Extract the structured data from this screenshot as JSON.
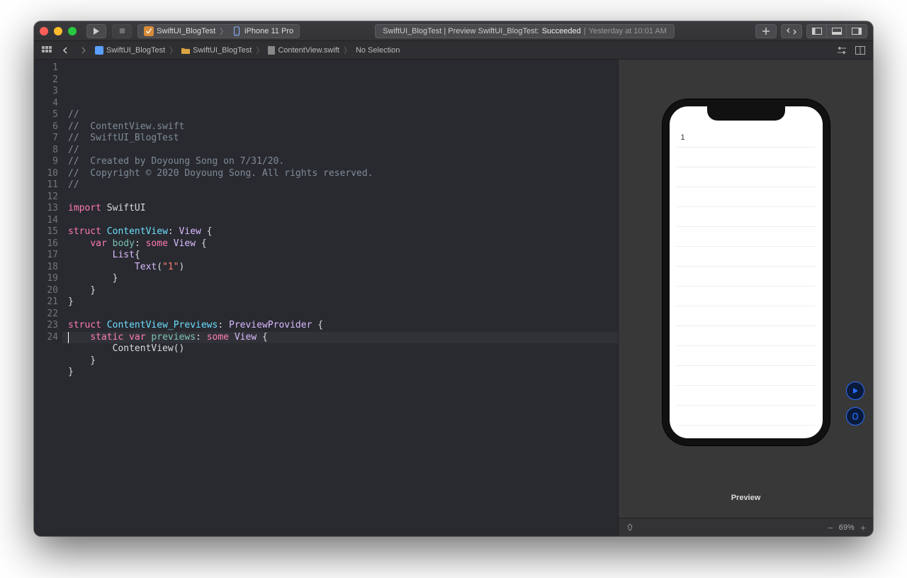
{
  "colors": {
    "accent_blue": "#2a6dff",
    "keyword_pink": "#ff7ab2",
    "type_purple": "#dabaff",
    "type_cyan": "#6bdfff",
    "prop_teal": "#78c2b3",
    "string_red": "#ff8170",
    "comment_gray": "#7f8c98"
  },
  "titlebar": {
    "run_tooltip": "Run",
    "stop_tooltip": "Stop",
    "scheme": {
      "project": "SwiftUI_BlogTest",
      "device": "iPhone 11 Pro"
    },
    "status": {
      "prefix": "SwiftUI_BlogTest | Preview SwiftUI_BlogTest: ",
      "state": "Succeeded",
      "time_sep": " | ",
      "time": "Yesterday at 10:01 AM"
    },
    "icons": {
      "plus": "plus-icon",
      "back_forward": "review-icon",
      "panel_left": "panel-left-icon",
      "panel_bottom": "panel-bottom-icon",
      "panel_right": "panel-right-icon"
    }
  },
  "jumpbar": {
    "items": [
      "SwiftUI_BlogTest",
      "SwiftUI_BlogTest",
      "ContentView.swift",
      "No Selection"
    ]
  },
  "code": {
    "lines": [
      {
        "n": 1,
        "segments": [
          {
            "t": "//",
            "c": "c-comment"
          }
        ]
      },
      {
        "n": 2,
        "segments": [
          {
            "t": "//  ContentView.swift",
            "c": "c-comment"
          }
        ]
      },
      {
        "n": 3,
        "segments": [
          {
            "t": "//  SwiftUI_BlogTest",
            "c": "c-comment"
          }
        ]
      },
      {
        "n": 4,
        "segments": [
          {
            "t": "//",
            "c": "c-comment"
          }
        ]
      },
      {
        "n": 5,
        "segments": [
          {
            "t": "//  Created by Doyoung Song on 7/31/20.",
            "c": "c-comment"
          }
        ]
      },
      {
        "n": 6,
        "segments": [
          {
            "t": "//  Copyright © 2020 Doyoung Song. All rights reserved.",
            "c": "c-comment"
          }
        ]
      },
      {
        "n": 7,
        "segments": [
          {
            "t": "//",
            "c": "c-comment"
          }
        ]
      },
      {
        "n": 8,
        "segments": []
      },
      {
        "n": 9,
        "segments": [
          {
            "t": "import",
            "c": "c-kw"
          },
          {
            "t": " SwiftUI",
            "c": "c-plain"
          }
        ]
      },
      {
        "n": 10,
        "segments": []
      },
      {
        "n": 11,
        "segments": [
          {
            "t": "struct",
            "c": "c-kw"
          },
          {
            "t": " ",
            "c": "c-plain"
          },
          {
            "t": "ContentView",
            "c": "c-type"
          },
          {
            "t": ": ",
            "c": "c-plain"
          },
          {
            "t": "View",
            "c": "c-type2"
          },
          {
            "t": " {",
            "c": "c-plain"
          }
        ]
      },
      {
        "n": 12,
        "segments": [
          {
            "t": "    ",
            "c": "c-plain"
          },
          {
            "t": "var",
            "c": "c-kw"
          },
          {
            "t": " ",
            "c": "c-plain"
          },
          {
            "t": "body",
            "c": "c-prop"
          },
          {
            "t": ": ",
            "c": "c-plain"
          },
          {
            "t": "some",
            "c": "c-kw"
          },
          {
            "t": " ",
            "c": "c-plain"
          },
          {
            "t": "View",
            "c": "c-type2"
          },
          {
            "t": " {",
            "c": "c-plain"
          }
        ]
      },
      {
        "n": 13,
        "segments": [
          {
            "t": "        ",
            "c": "c-plain"
          },
          {
            "t": "List",
            "c": "c-type2"
          },
          {
            "t": "{",
            "c": "c-plain"
          }
        ]
      },
      {
        "n": 14,
        "segments": [
          {
            "t": "            ",
            "c": "c-plain"
          },
          {
            "t": "Text",
            "c": "c-type2"
          },
          {
            "t": "(",
            "c": "c-plain"
          },
          {
            "t": "\"1\"",
            "c": "c-str"
          },
          {
            "t": ")",
            "c": "c-plain"
          }
        ]
      },
      {
        "n": 15,
        "segments": [
          {
            "t": "        }",
            "c": "c-plain"
          }
        ]
      },
      {
        "n": 16,
        "segments": [
          {
            "t": "    }",
            "c": "c-plain"
          }
        ]
      },
      {
        "n": 17,
        "segments": [
          {
            "t": "}",
            "c": "c-plain"
          }
        ]
      },
      {
        "n": 18,
        "segments": []
      },
      {
        "n": 19,
        "segments": [
          {
            "t": "struct",
            "c": "c-kw"
          },
          {
            "t": " ",
            "c": "c-plain"
          },
          {
            "t": "ContentView_Previews",
            "c": "c-type"
          },
          {
            "t": ": ",
            "c": "c-plain"
          },
          {
            "t": "PreviewProvider",
            "c": "c-type2"
          },
          {
            "t": " {",
            "c": "c-plain"
          }
        ]
      },
      {
        "n": 20,
        "segments": [
          {
            "t": "    ",
            "c": "c-plain"
          },
          {
            "t": "static",
            "c": "c-kw"
          },
          {
            "t": " ",
            "c": "c-plain"
          },
          {
            "t": "var",
            "c": "c-kw"
          },
          {
            "t": " ",
            "c": "c-plain"
          },
          {
            "t": "previews",
            "c": "c-prop"
          },
          {
            "t": ": ",
            "c": "c-plain"
          },
          {
            "t": "some",
            "c": "c-kw"
          },
          {
            "t": " ",
            "c": "c-plain"
          },
          {
            "t": "View",
            "c": "c-type2"
          },
          {
            "t": " {",
            "c": "c-plain"
          }
        ]
      },
      {
        "n": 21,
        "segments": [
          {
            "t": "        ContentView()",
            "c": "c-plain"
          }
        ]
      },
      {
        "n": 22,
        "segments": [
          {
            "t": "    }",
            "c": "c-plain"
          }
        ]
      },
      {
        "n": 23,
        "segments": [
          {
            "t": "}",
            "c": "c-plain"
          }
        ]
      },
      {
        "n": 24,
        "segments": []
      }
    ]
  },
  "preview": {
    "label": "Preview",
    "list_item": "1",
    "zoom": "69%",
    "empty_rows": 14
  }
}
